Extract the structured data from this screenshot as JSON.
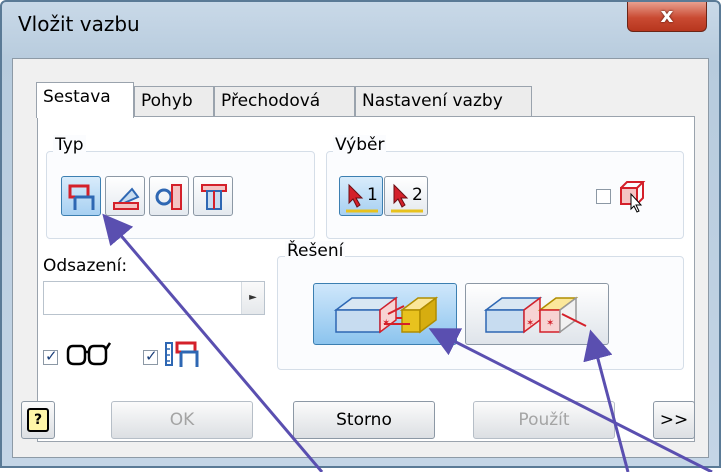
{
  "window": {
    "title": "Vložit vazbu",
    "close_glyph": "x"
  },
  "tabs": [
    {
      "label": "Sestava",
      "active": true
    },
    {
      "label": "Pohyb",
      "active": false
    },
    {
      "label": "Přechodová",
      "active": false
    },
    {
      "label": "Nastavení vazby",
      "active": false
    }
  ],
  "type_group": {
    "label": "Typ",
    "buttons": [
      {
        "icon": "mate-icon",
        "selected": true
      },
      {
        "icon": "angle-icon",
        "selected": false
      },
      {
        "icon": "tangent-icon",
        "selected": false
      },
      {
        "icon": "insert-icon",
        "selected": false
      }
    ]
  },
  "selection_group": {
    "label": "Výběr",
    "select1_label": "1",
    "select2_label": "2",
    "first_click_checked": false
  },
  "offset": {
    "label": "Odsazení:",
    "value": "",
    "spin_glyph": "►"
  },
  "options": {
    "preview_checked": true,
    "predict_offset_checked": true
  },
  "solution_group": {
    "label": "Řešení",
    "buttons": [
      {
        "icon": "mate-solution-icon",
        "selected": true
      },
      {
        "icon": "flush-solution-icon",
        "selected": false
      }
    ]
  },
  "footer": {
    "help_glyph": "?",
    "ok_label": "OK",
    "cancel_label": "Storno",
    "apply_label": "Použít",
    "more_label": ">>"
  },
  "colors": {
    "accent": "#3c7fb1",
    "annotation_arrows": "#5a4fb0",
    "icon_red": "#d4202a",
    "icon_blue": "#2e67b3",
    "icon_yellow": "#e8c21e"
  }
}
